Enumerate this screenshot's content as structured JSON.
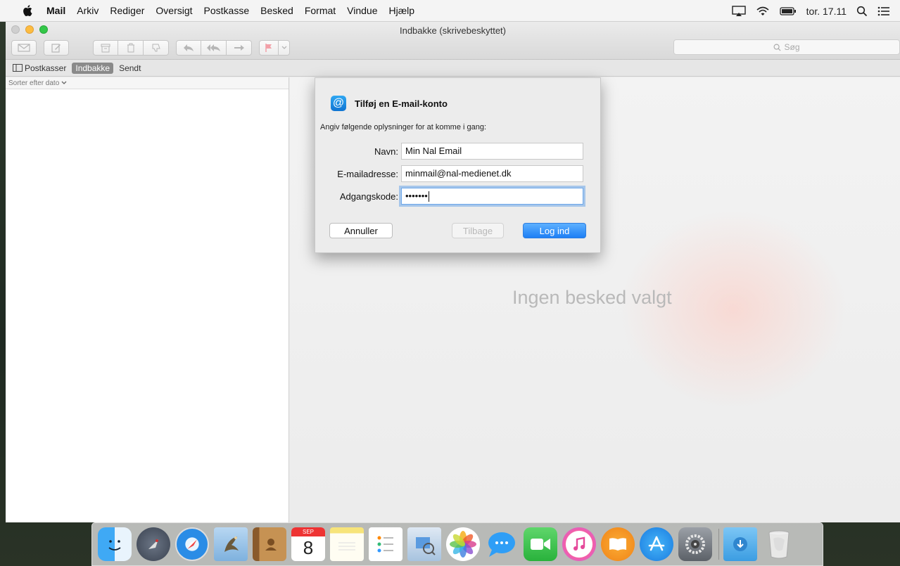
{
  "menubar": {
    "app_name": "Mail",
    "items": [
      "Arkiv",
      "Rediger",
      "Oversigt",
      "Postkasse",
      "Besked",
      "Format",
      "Vindue",
      "Hjælp"
    ],
    "clock": "tor. 17.11"
  },
  "window": {
    "title": "Indbakke (skrivebeskyttet)",
    "search_placeholder": "Søg",
    "favorites": {
      "mailboxes": "Postkasser",
      "inbox": "Indbakke",
      "sent": "Sendt"
    },
    "sort_label": "Sorter efter dato",
    "no_message": "Ingen besked valgt"
  },
  "sheet": {
    "title": "Tilføj en E-mail-konto",
    "subtitle": "Angiv følgende oplysninger for at komme i gang:",
    "name_label": "Navn:",
    "name_value": "Min Nal Email",
    "email_label": "E-mailadresse:",
    "email_value": "minmail@nal-medienet.dk",
    "password_label": "Adgangskode:",
    "password_value": "•••••••",
    "cancel_button": "Annuller",
    "back_button": "Tilbage",
    "login_button": "Log ind"
  },
  "dock": {
    "calendar_month": "SEP",
    "calendar_day": "8",
    "apps": [
      "finder-icon",
      "launchpad-icon",
      "safari-icon",
      "mail-icon",
      "contacts-icon",
      "calendar-icon",
      "notes-icon",
      "reminders-icon",
      "preview-icon",
      "photos-icon",
      "messages-icon",
      "facetime-icon",
      "itunes-icon",
      "ibooks-icon",
      "app-store-icon",
      "system-preferences-icon",
      "downloads-icon",
      "trash-icon"
    ]
  },
  "colors": {
    "accent": "#1d7ff5",
    "focus_ring": "#6ea8ea",
    "traffic_min": "#fdbc40",
    "traffic_max": "#33c748"
  }
}
